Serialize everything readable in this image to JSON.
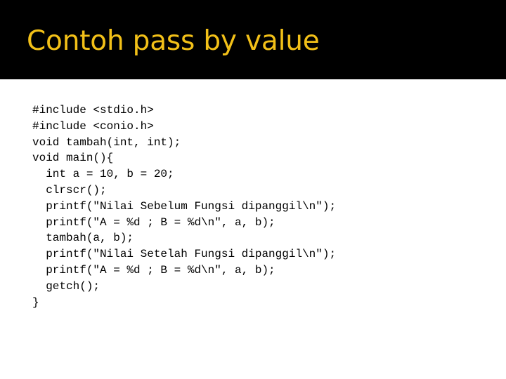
{
  "slide": {
    "title": "Contoh pass by value",
    "title_color": "#f2c018",
    "header_background": "#000000",
    "body_background": "#ffffff",
    "code_color": "#000000"
  },
  "code": {
    "language": "c",
    "lines": [
      "#include <stdio.h>",
      "#include <conio.h>",
      "void tambah(int, int);",
      "void main(){",
      "  int a = 10, b = 20;",
      "  clrscr();",
      "  printf(\"Nilai Sebelum Fungsi dipanggil\\n\");",
      "  printf(\"A = %d ; B = %d\\n\", a, b);",
      "  tambah(a, b);",
      "  printf(\"Nilai Setelah Fungsi dipanggil\\n\");",
      "  printf(\"A = %d ; B = %d\\n\", a, b);",
      "  getch();",
      "}"
    ]
  }
}
